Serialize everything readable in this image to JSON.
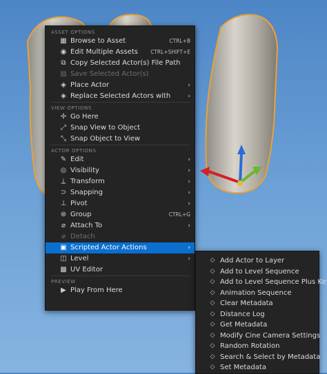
{
  "main_menu": {
    "sections": [
      {
        "header": "ASSET OPTIONS",
        "items": [
          {
            "label": "Browse to Asset",
            "shortcut": "CTRL+B",
            "icon": "browse-icon",
            "glyph": "▦"
          },
          {
            "label": "Edit Multiple Assets",
            "shortcut": "CTRL+SHIFT+E",
            "icon": "edit-assets-icon",
            "glyph": "◉"
          },
          {
            "label": "Copy Selected Actor(s) File Path",
            "icon": "copy-path-icon",
            "glyph": "⧉"
          },
          {
            "label": "Save Selected Actor(s)",
            "icon": "save-icon",
            "glyph": "▤",
            "disabled": true
          },
          {
            "label": "Place Actor",
            "icon": "place-actor-icon",
            "glyph": "◈",
            "submenu": true
          },
          {
            "label": "Replace Selected Actors with",
            "icon": "replace-actors-icon",
            "glyph": "◈",
            "submenu": true
          }
        ]
      },
      {
        "header": "VIEW OPTIONS",
        "items": [
          {
            "label": "Go Here",
            "icon": "go-here-icon",
            "glyph": "✢"
          },
          {
            "label": "Snap View to Object",
            "icon": "snap-view-icon",
            "glyph": "⤢"
          },
          {
            "label": "Snap Object to View",
            "icon": "snap-object-icon",
            "glyph": "⤡"
          }
        ]
      },
      {
        "header": "ACTOR OPTIONS",
        "items": [
          {
            "label": "Edit",
            "icon": "pencil-icon",
            "glyph": "✎",
            "submenu": true
          },
          {
            "label": "Visibility",
            "icon": "eye-icon",
            "glyph": "◎",
            "submenu": true
          },
          {
            "label": "Transform",
            "icon": "transform-icon",
            "glyph": "⟂",
            "submenu": true
          },
          {
            "label": "Snapping",
            "icon": "magnet-icon",
            "glyph": "⊃",
            "submenu": true
          },
          {
            "label": "Pivot",
            "icon": "pivot-icon",
            "glyph": "⊥",
            "submenu": true
          },
          {
            "label": "Group",
            "shortcut": "CTRL+G",
            "icon": "group-icon",
            "glyph": "⊛"
          },
          {
            "label": "Attach To",
            "icon": "attach-icon",
            "glyph": "⌀",
            "submenu": true
          },
          {
            "label": "Detach",
            "icon": "detach-icon",
            "glyph": "⌀",
            "disabled": true
          },
          {
            "label": "Scripted Actor Actions",
            "icon": "script-icon",
            "glyph": "▣",
            "submenu": true,
            "selected": true
          },
          {
            "label": "Level",
            "icon": "level-icon",
            "glyph": "◫",
            "submenu": true
          },
          {
            "label": "UV Editor",
            "icon": "uv-editor-icon",
            "glyph": "▩"
          }
        ]
      },
      {
        "header": "PREVIEW",
        "items": [
          {
            "label": "Play From Here",
            "icon": "play-icon",
            "glyph": "▶"
          }
        ]
      }
    ]
  },
  "scripted_actions_submenu": {
    "items": [
      "Add Actor to Layer",
      "Add to Level Sequence",
      "Add to Level Sequence Plus Key",
      "Animation Sequence",
      "Clear Metadata",
      "Distance Log",
      "Get Metadata",
      "Modify Cine Camera Settings",
      "Random Rotation",
      "Search & Select by Metadata",
      "Set Metadata"
    ],
    "icon": "action-diamond-icon",
    "glyph": "◇"
  },
  "colors": {
    "sky": "#5f96d0",
    "menu_bg": "#242424",
    "highlight": "#0a6fcf",
    "selection_outline": "#e8a23a",
    "gizmo_x": "#d22222",
    "gizmo_y": "#6ab82d",
    "gizmo_z": "#2b6bd8"
  }
}
